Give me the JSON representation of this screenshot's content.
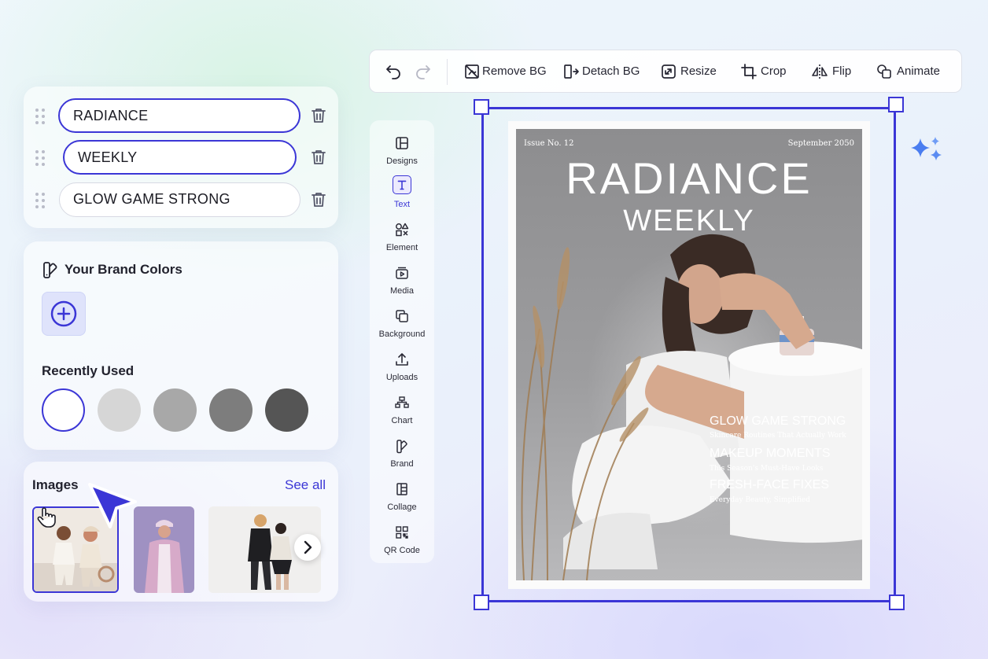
{
  "text_layers": [
    {
      "value": "RADIANCE",
      "active": true
    },
    {
      "value": "WEEKLY",
      "active": true
    },
    {
      "value": "GLOW GAME STRONG",
      "active": false
    }
  ],
  "brand": {
    "title": "Your Brand Colors",
    "recent_title": "Recently Used",
    "recent_colors": [
      "#ffffff",
      "#d6d6d6",
      "#a8a8a8",
      "#7d7d7d",
      "#555555"
    ]
  },
  "images": {
    "title": "Images",
    "see_all": "See all"
  },
  "toolbar": {
    "remove_bg": "Remove BG",
    "detach_bg": "Detach BG",
    "resize": "Resize",
    "crop": "Crop",
    "flip": "Flip",
    "animate": "Animate"
  },
  "rail": [
    {
      "label": "Designs",
      "icon": "layout-icon"
    },
    {
      "label": "Text",
      "icon": "text-icon",
      "active": true
    },
    {
      "label": "Element",
      "icon": "shapes-icon"
    },
    {
      "label": "Media",
      "icon": "media-icon"
    },
    {
      "label": "Background",
      "icon": "background-icon"
    },
    {
      "label": "Uploads",
      "icon": "upload-icon"
    },
    {
      "label": "Chart",
      "icon": "chart-icon"
    },
    {
      "label": "Brand",
      "icon": "brand-icon"
    },
    {
      "label": "Collage",
      "icon": "collage-icon"
    },
    {
      "label": "QR Code",
      "icon": "qr-code-icon"
    }
  ],
  "poster": {
    "issue": "Issue No. 12",
    "date": "September 2050",
    "title": "RADIANCE",
    "subtitle": "WEEKLY",
    "headlines": [
      {
        "title": "GLOW GAME STRONG",
        "sub": "Skincare Routines That Actually Work"
      },
      {
        "title": "MAKEUP MOMENTS",
        "sub": "This Season's Must-Have Looks"
      },
      {
        "title": "FRESH-FACE FIXES",
        "sub": "Everyday Beauty, Simplified"
      }
    ]
  },
  "colors": {
    "accent": "#3b36d6",
    "sparkle": "#4a7df0"
  }
}
